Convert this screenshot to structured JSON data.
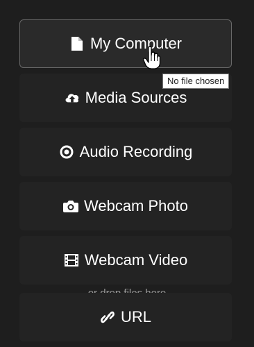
{
  "sources": [
    {
      "label": "My Computer",
      "icon": "file-icon"
    },
    {
      "label": "Media Sources",
      "icon": "cloud-upload-icon"
    },
    {
      "label": "Audio Recording",
      "icon": "record-icon"
    },
    {
      "label": "Webcam Photo",
      "icon": "camera-icon"
    },
    {
      "label": "Webcam Video",
      "icon": "film-icon"
    },
    {
      "label": "URL",
      "icon": "link-icon"
    }
  ],
  "drop_hint": "or drop files here",
  "tooltip": "No file chosen",
  "colors": {
    "background": "#1e1e1e",
    "button": "#232323",
    "selected_border": "#6a6a6a",
    "text": "#ffffff"
  }
}
